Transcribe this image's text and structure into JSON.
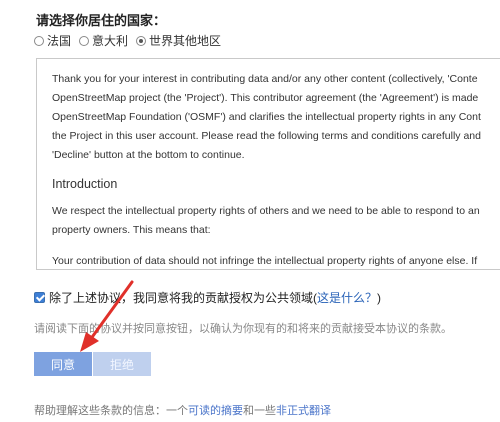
{
  "residence": {
    "question": "请选择你居住的国家：",
    "options": [
      {
        "label": "法国",
        "checked": false
      },
      {
        "label": "意大利",
        "checked": false
      },
      {
        "label": "世界其他地区",
        "checked": true
      }
    ]
  },
  "terms": {
    "lines": [
      "Thank you for your interest in contributing data and/or any other content (collectively, 'Conte",
      "OpenStreetMap project (the 'Project'). This contributor agreement (the 'Agreement') is made",
      "OpenStreetMap Foundation ('OSMF') and clarifies the intellectual property rights in any Cont",
      "the Project in this user account. Please read the following terms and conditions carefully and",
      "'Decline' button at the bottom to continue."
    ],
    "heading": "Introduction",
    "intro_lines": [
      "We respect the intellectual property rights of others and we need to be able to respond to an",
      "property owners. This means that:"
    ],
    "cutoff_line": "Your contribution of data should not infringe the intellectual property rights of anyone else. If"
  },
  "public_domain": {
    "label": "除了上述协议，我同意将我的贡献授权为公共领域",
    "link_open": " (",
    "link": "这是什么？",
    "link_close": ")",
    "checked": true
  },
  "hint": "请阅读下面的协议并按同意按钮，以确认为你现有的和将来的贡献接受本协议的条款。",
  "buttons": {
    "agree": "同意",
    "decline": "拒绝"
  },
  "footer": {
    "prefix": "帮助理解这些条款的信息：一个",
    "link1": "可读的摘要",
    "middle": "和一些",
    "link2": "非正式翻译"
  },
  "colors": {
    "annotation_arrow": "#e0302a",
    "link": "#2b64b8",
    "agree_button": "#7ea2e0"
  }
}
